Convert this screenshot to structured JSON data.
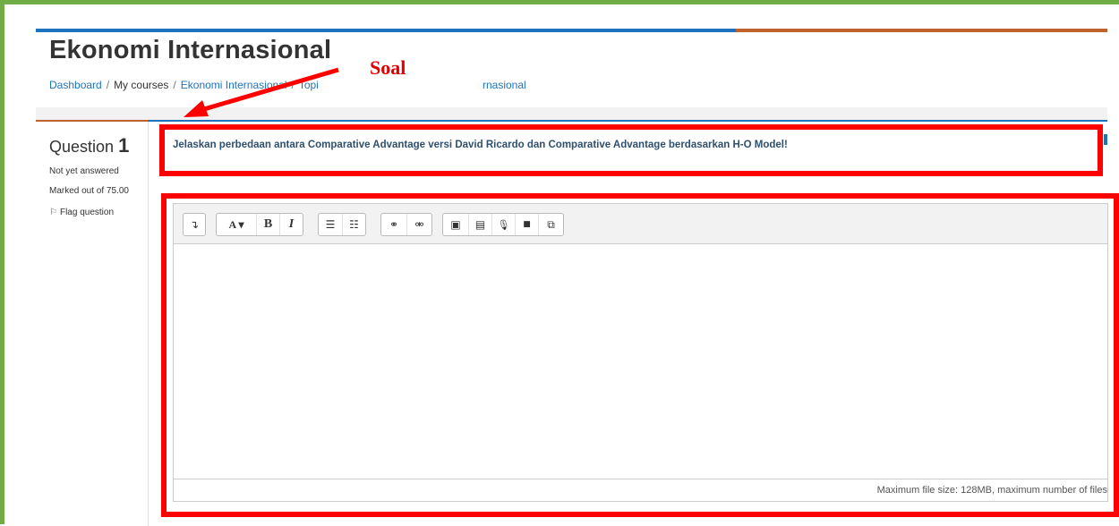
{
  "course": {
    "title": "Ekonomi Internasional"
  },
  "breadcrumb": {
    "items": [
      "Dashboard",
      "My courses",
      "Ekonomi Internasional",
      "Topi"
    ],
    "tail": "rnasional"
  },
  "question": {
    "label": "Question",
    "number": "1",
    "state": "Not yet answered",
    "grade": "Marked out of 75.00",
    "flag_label": "Flag question",
    "text": "Jelaskan perbedaan antara Comparative Advantage versi David Ricardo dan Comparative Advantage berdasarkan H-O Model!"
  },
  "editor": {
    "toolbar": {
      "collapse": "↴",
      "font": "A ▾",
      "bold": "B",
      "italic": "I",
      "unordered_list": "☰",
      "ordered_list": "☷",
      "link": "⚭",
      "unlink": "⚮",
      "image": "▣",
      "media": "▤",
      "record_audio": "🎙",
      "record_video": "■",
      "manage_files": "⧉"
    },
    "footer": "Maximum file size: 128MB, maximum number of files"
  },
  "annotation": {
    "label": "Soal"
  },
  "colors": {
    "frame": "#70ad47",
    "accent_blue": "#1e73be",
    "accent_orange": "#c0622e",
    "annotation_red": "#ff0000"
  }
}
